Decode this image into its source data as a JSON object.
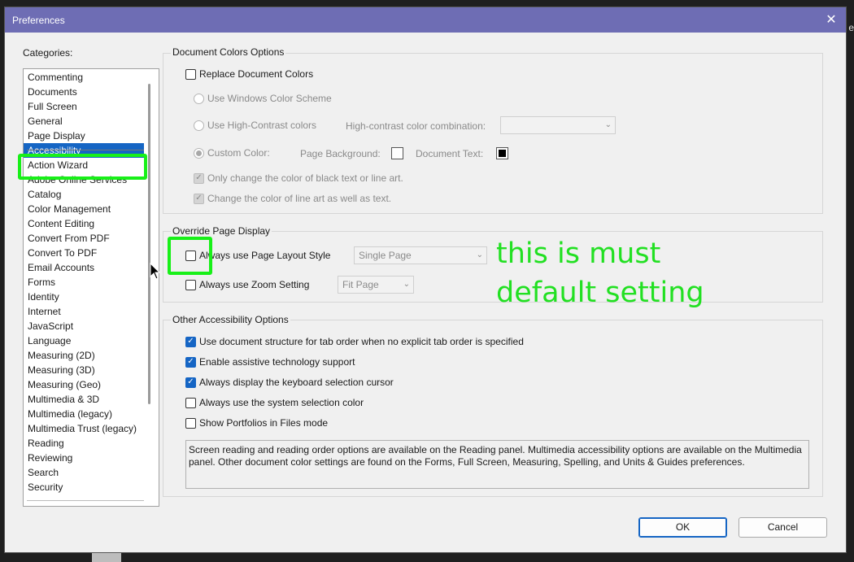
{
  "background": {
    "edge_text": "e"
  },
  "window": {
    "title": "Preferences",
    "close_glyph": "✕"
  },
  "categories": {
    "label": "Categories:",
    "items": [
      "Commenting",
      "Documents",
      "Full Screen",
      "General",
      "Page Display",
      "Accessibility",
      "Action Wizard",
      "Adobe Online Services",
      "Catalog",
      "Color Management",
      "Content Editing",
      "Convert From PDF",
      "Convert To PDF",
      "Email Accounts",
      "Forms",
      "Identity",
      "Internet",
      "JavaScript",
      "Language",
      "Measuring (2D)",
      "Measuring (3D)",
      "Measuring (Geo)",
      "Multimedia & 3D",
      "Multimedia (legacy)",
      "Multimedia Trust (legacy)",
      "Reading",
      "Reviewing",
      "Search",
      "Security"
    ],
    "selected": "Accessibility"
  },
  "document_colors": {
    "title": "Document Colors Options",
    "replace_label": "Replace Document Colors",
    "replace_checked": false,
    "windows_scheme_label": "Use Windows Color Scheme",
    "high_contrast_label": "Use High-Contrast colors",
    "high_contrast_combo_label": "High-contrast color combination:",
    "high_contrast_combo_value": "",
    "custom_color_label": "Custom Color:",
    "page_background_label": "Page Background:",
    "document_text_label": "Document Text:",
    "only_black_label": "Only change the color of black text or line art.",
    "line_art_label": "Change the color of line art as well as text."
  },
  "override": {
    "title": "Override Page Display",
    "layout_label": "Always use Page Layout Style",
    "layout_checked": false,
    "layout_value": "Single Page",
    "zoom_label": "Always use Zoom Setting",
    "zoom_checked": false,
    "zoom_value": "Fit Page"
  },
  "other": {
    "title": "Other Accessibility Options",
    "options": [
      {
        "label": "Use document structure for tab order when no explicit tab order is specified",
        "checked": true
      },
      {
        "label": "Enable assistive technology support",
        "checked": true
      },
      {
        "label": "Always display the keyboard selection cursor",
        "checked": true
      },
      {
        "label": "Always use the system selection color",
        "checked": false
      },
      {
        "label": "Show Portfolios in Files mode",
        "checked": false
      }
    ],
    "info": "Screen reading and reading order options are available on the Reading panel. Multimedia accessibility options are available on the Multimedia panel. Other document color settings are found on the Forms, Full Screen, Measuring, Spelling, and Units & Guides preferences."
  },
  "annotation": {
    "line1": "this is must",
    "line2": "default setting",
    "color": "#22e022"
  },
  "buttons": {
    "ok": "OK",
    "cancel": "Cancel"
  }
}
